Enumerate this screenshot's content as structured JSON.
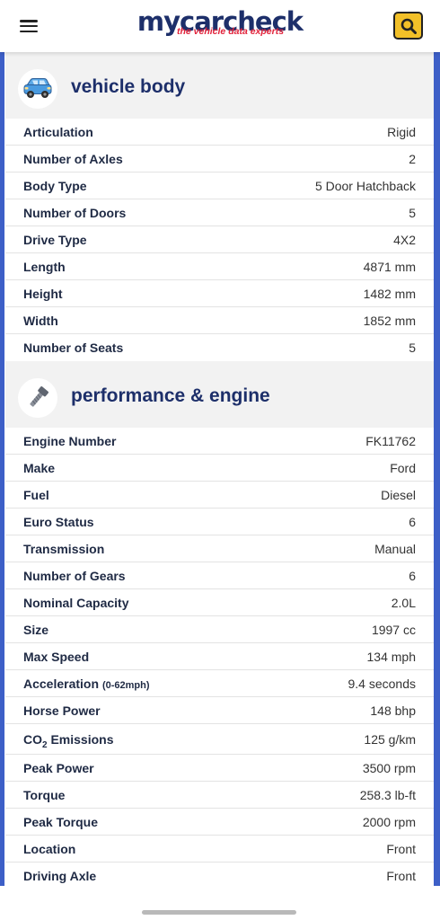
{
  "header": {
    "logo_main": "mycarcheck",
    "logo_tagline": "the vehicle data experts"
  },
  "colors": {
    "brand_navy": "#1d2f6a",
    "brand_red": "#e2233b",
    "search_yellow": "#f2c028",
    "frame_blue": "#3d5fc7"
  },
  "sections": {
    "body": {
      "title": "vehicle body",
      "icon": "car-icon",
      "rows": [
        {
          "label": "Articulation",
          "value": "Rigid"
        },
        {
          "label": "Number of Axles",
          "value": "2"
        },
        {
          "label": "Body Type",
          "value": "5 Door Hatchback"
        },
        {
          "label": "Number of Doors",
          "value": "5"
        },
        {
          "label": "Drive Type",
          "value": "4X2"
        },
        {
          "label": "Length",
          "value": "4871 mm"
        },
        {
          "label": "Height",
          "value": "1482 mm"
        },
        {
          "label": "Width",
          "value": "1852 mm"
        },
        {
          "label": "Number of Seats",
          "value": "5"
        }
      ]
    },
    "engine": {
      "title": "performance & engine",
      "icon": "bolt-wrench-icon",
      "rows": [
        {
          "label": "Engine Number",
          "value": "FK11762"
        },
        {
          "label": "Make",
          "value": "Ford"
        },
        {
          "label": "Fuel",
          "value": "Diesel"
        },
        {
          "label": "Euro Status",
          "value": "6"
        },
        {
          "label": "Transmission",
          "value": "Manual"
        },
        {
          "label": "Number of Gears",
          "value": "6"
        },
        {
          "label": "Nominal Capacity",
          "value": "2.0L"
        },
        {
          "label": "Size",
          "value": "1997 cc"
        },
        {
          "label": "Max Speed",
          "value": "134 mph"
        },
        {
          "label": "Acceleration",
          "label_suffix": "(0-62mph)",
          "value": "9.4 seconds"
        },
        {
          "label": "Horse Power",
          "value": "148 bhp"
        },
        {
          "label_co2_prefix": "CO",
          "label_co2_sub": "2",
          "label_co2_suffix": " Emissions",
          "value": "125 g/km"
        },
        {
          "label": "Peak Power",
          "value": "3500 rpm"
        },
        {
          "label": "Torque",
          "value": "258.3 lb-ft"
        },
        {
          "label": "Peak Torque",
          "value": "2000 rpm"
        },
        {
          "label": "Location",
          "value": "Front"
        },
        {
          "label": "Driving Axle",
          "value": "Front"
        }
      ]
    }
  }
}
